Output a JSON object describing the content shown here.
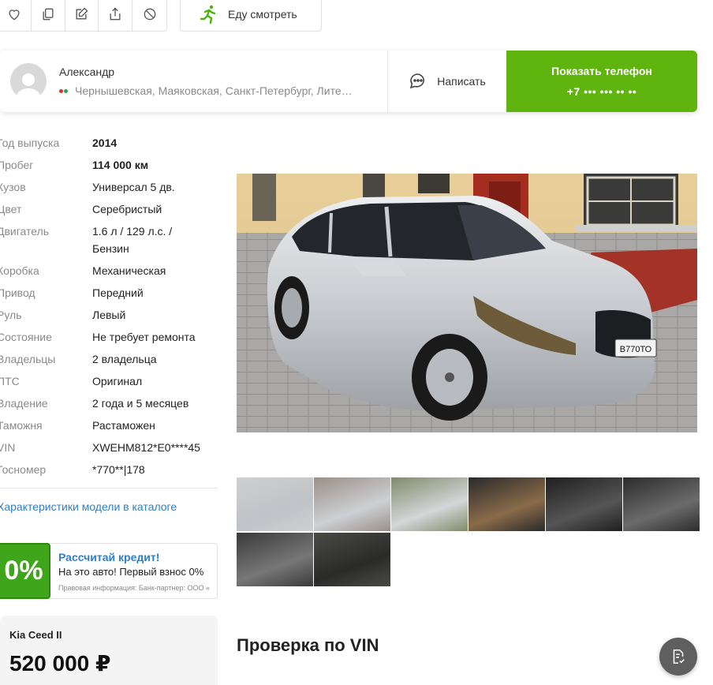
{
  "actions": {
    "favorite_icon": "heart-icon",
    "compare_icon": "compare-icon",
    "note_icon": "edit-note-icon",
    "share_icon": "share-icon",
    "block_icon": "block-icon",
    "watch_label": "Еду смотреть"
  },
  "seller": {
    "name": "Александр",
    "location": "Чернышевская, Маяковская, Санкт-Петербург, Лите…",
    "write_label": "Написать",
    "phone_title": "Показать телефон",
    "phone_masked": "+7 ••• ••• •• ••"
  },
  "specs": [
    {
      "label": "Год выпуска",
      "value": "2014",
      "bold": true
    },
    {
      "label": "Пробег",
      "value": "114 000 км",
      "bold": true
    },
    {
      "label": "Кузов",
      "value": "Универсал 5 дв."
    },
    {
      "label": "Цвет",
      "value": "Серебристый"
    },
    {
      "label": "Двигатель",
      "value": "1.6 л / 129 л.с. / Бензин"
    },
    {
      "label": "Коробка",
      "value": "Механическая"
    },
    {
      "label": "Привод",
      "value": "Передний"
    },
    {
      "label": "Руль",
      "value": "Левый"
    },
    {
      "label": "Состояние",
      "value": "Не требует ремонта"
    },
    {
      "label": "Владельцы",
      "value": "2 владельца"
    },
    {
      "label": "ПТС",
      "value": "Оригинал"
    },
    {
      "label": "Владение",
      "value": "2 года и 5 месяцев"
    },
    {
      "label": "Таможня",
      "value": "Растаможен"
    },
    {
      "label": "VIN",
      "value": "XWEHM812*E0****45"
    },
    {
      "label": "Госномер",
      "value": "*770**|178"
    }
  ],
  "catalog_link": "Характеристики модели в каталоге",
  "credit": {
    "badge": "0%",
    "title": "Рассчитай кредит!",
    "subtitle": "На это авто! Первый взнос 0%",
    "legal": "Правовая информация: Банк-партнер: ООО «"
  },
  "price_card": {
    "model": "Kia Ceed II",
    "price": "520 000 ₽"
  },
  "plate_text": "В770ТО",
  "thumbnail_count": 8,
  "vin_section_title": "Проверка по VIN",
  "fab_icon": "report-check-icon"
}
